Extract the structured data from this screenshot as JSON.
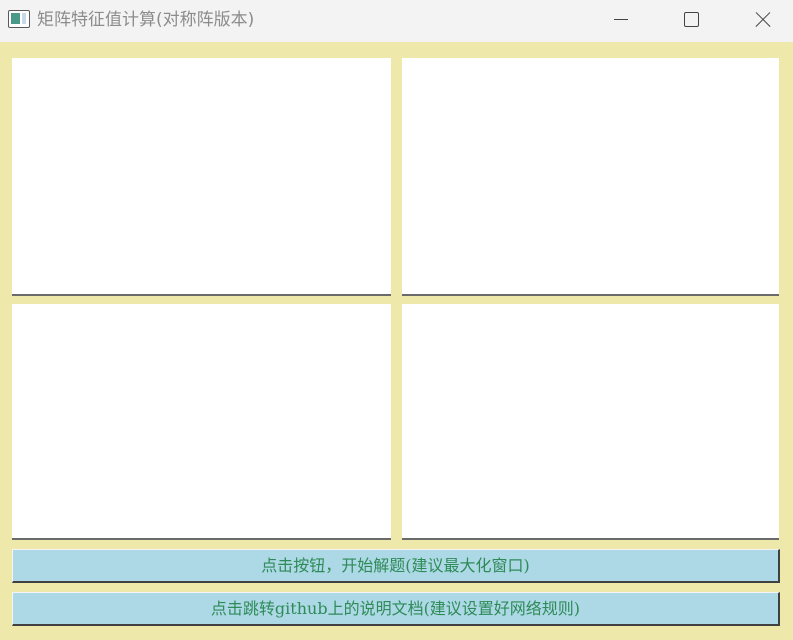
{
  "window": {
    "title": "矩阵特征值计算(对称阵版本)",
    "icon": "app-window-icon"
  },
  "titlebar_buttons": {
    "minimize_icon": "minimize-icon",
    "maximize_icon": "maximize-icon",
    "close_icon": "close-icon"
  },
  "panels": [
    {
      "name": "panel-top-left"
    },
    {
      "name": "panel-top-right"
    },
    {
      "name": "panel-bottom-left"
    },
    {
      "name": "panel-bottom-right"
    }
  ],
  "buttons": {
    "solve_label": "点击按钮，开始解题(建议最大化窗口)",
    "github_label": "点击跳转github上的说明文档(建议设置好网络规则)"
  },
  "colors": {
    "background": "#eee8aa",
    "panel": "#ffffff",
    "button_bg": "#add8e6",
    "button_text": "#2e8b57"
  }
}
